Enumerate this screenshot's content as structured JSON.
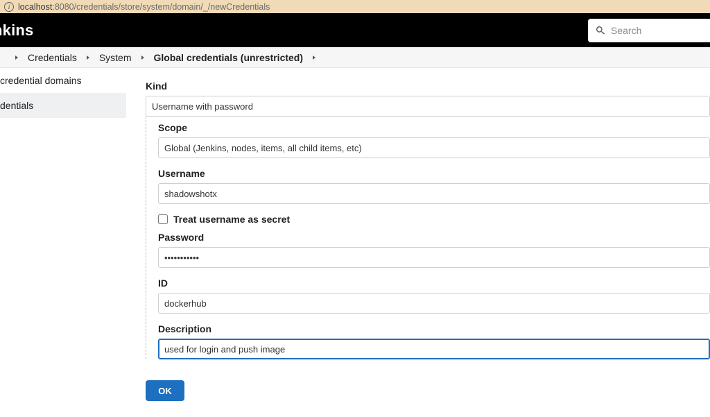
{
  "address": {
    "host": "localhost",
    "port_path": ":8080/credentials/store/system/domain/_/newCredentials"
  },
  "brand": "nkins",
  "search": {
    "placeholder": "Search"
  },
  "breadcrumbs": {
    "items": [
      "Credentials",
      "System",
      "Global credentials (unrestricted)"
    ],
    "current_index": 2
  },
  "sidebar": {
    "items": [
      {
        "label": "credential domains"
      },
      {
        "label": "dentials"
      }
    ],
    "active_index": 1
  },
  "form": {
    "kind": {
      "label": "Kind",
      "value": "Username with password"
    },
    "scope": {
      "label": "Scope",
      "value": "Global (Jenkins, nodes, items, all child items, etc)"
    },
    "username": {
      "label": "Username",
      "value": "shadowshotx"
    },
    "treat_secret": {
      "label": "Treat username as secret",
      "checked": false
    },
    "password": {
      "label": "Password",
      "value": "•••••••••••"
    },
    "id": {
      "label": "ID",
      "value": "dockerhub"
    },
    "description": {
      "label": "Description",
      "value": "used for login and push image"
    },
    "ok": "OK"
  }
}
